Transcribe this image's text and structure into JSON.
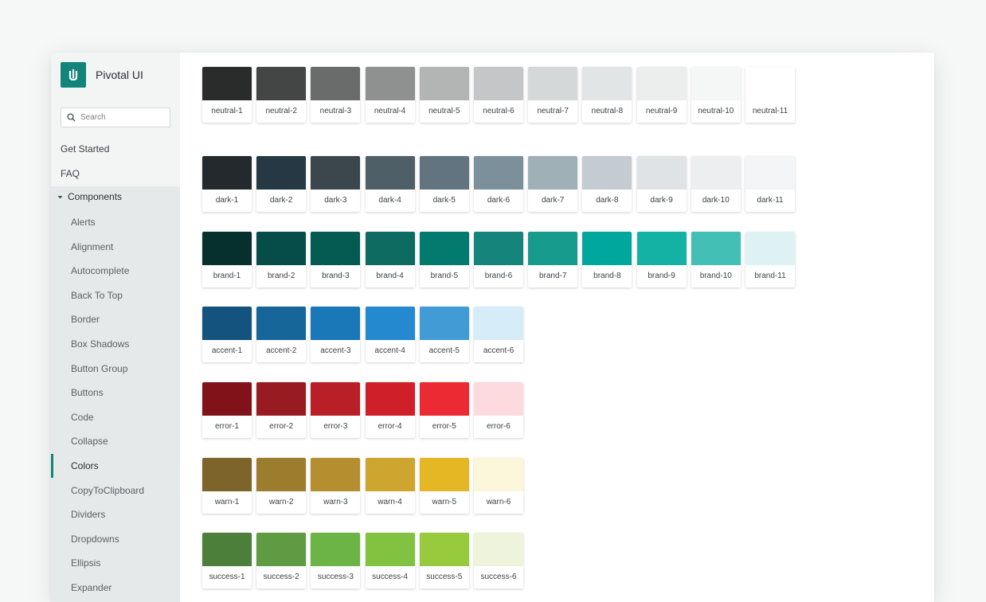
{
  "app": {
    "name": "Pivotal UI"
  },
  "search": {
    "placeholder": "Search"
  },
  "nav": {
    "top_items": [
      "Get Started",
      "FAQ"
    ],
    "section_label": "Components",
    "items": [
      "Alerts",
      "Alignment",
      "Autocomplete",
      "Back To Top",
      "Border",
      "Box Shadows",
      "Button Group",
      "Buttons",
      "Code",
      "Collapse",
      "Colors",
      "CopyToClipboard",
      "Dividers",
      "Dropdowns",
      "Ellipsis",
      "Expander"
    ],
    "active_item": "Colors"
  },
  "palette": [
    {
      "group": "neutral",
      "swatches": [
        {
          "name": "neutral-1",
          "color": "#2a2b2b"
        },
        {
          "name": "neutral-2",
          "color": "#444545"
        },
        {
          "name": "neutral-3",
          "color": "#6a6b6b"
        },
        {
          "name": "neutral-4",
          "color": "#8f9090"
        },
        {
          "name": "neutral-5",
          "color": "#b3b4b4"
        },
        {
          "name": "neutral-6",
          "color": "#c5c6c7"
        },
        {
          "name": "neutral-7",
          "color": "#d4d8d8"
        },
        {
          "name": "neutral-8",
          "color": "#e2e5e5"
        },
        {
          "name": "neutral-9",
          "color": "#eceeee"
        },
        {
          "name": "neutral-10",
          "color": "#f5f6f6"
        },
        {
          "name": "neutral-11",
          "color": "#ffffff"
        }
      ]
    },
    {
      "group": "dark",
      "swatches": [
        {
          "name": "dark-1",
          "color": "#23292d"
        },
        {
          "name": "dark-2",
          "color": "#263844"
        },
        {
          "name": "dark-3",
          "color": "#3b464d"
        },
        {
          "name": "dark-4",
          "color": "#4f5f67"
        },
        {
          "name": "dark-5",
          "color": "#627480"
        },
        {
          "name": "dark-6",
          "color": "#7b909a"
        },
        {
          "name": "dark-7",
          "color": "#9fb0b7"
        },
        {
          "name": "dark-8",
          "color": "#c4ccd1"
        },
        {
          "name": "dark-9",
          "color": "#dfe3e5"
        },
        {
          "name": "dark-10",
          "color": "#eceef0"
        },
        {
          "name": "dark-11",
          "color": "#f4f5f6"
        }
      ]
    },
    {
      "group": "brand",
      "swatches": [
        {
          "name": "brand-1",
          "color": "#05302e"
        },
        {
          "name": "brand-2",
          "color": "#064d4a"
        },
        {
          "name": "brand-3",
          "color": "#055a52"
        },
        {
          "name": "brand-4",
          "color": "#0e6b62"
        },
        {
          "name": "brand-5",
          "color": "#037a6e"
        },
        {
          "name": "brand-6",
          "color": "#15847b"
        },
        {
          "name": "brand-7",
          "color": "#179b8d"
        },
        {
          "name": "brand-8",
          "color": "#00a79d"
        },
        {
          "name": "brand-9",
          "color": "#14b2a4"
        },
        {
          "name": "brand-10",
          "color": "#43bfb6"
        },
        {
          "name": "brand-11",
          "color": "#dff2f3"
        }
      ]
    },
    {
      "group": "accent",
      "swatches": [
        {
          "name": "accent-1",
          "color": "#14537d"
        },
        {
          "name": "accent-2",
          "color": "#16669a"
        },
        {
          "name": "accent-3",
          "color": "#1b78b8"
        },
        {
          "name": "accent-4",
          "color": "#2589cf"
        },
        {
          "name": "accent-5",
          "color": "#419cd6"
        },
        {
          "name": "accent-6",
          "color": "#d6ecf9"
        }
      ]
    },
    {
      "group": "error",
      "swatches": [
        {
          "name": "error-1",
          "color": "#81121a"
        },
        {
          "name": "error-2",
          "color": "#991b22"
        },
        {
          "name": "error-3",
          "color": "#b81f27"
        },
        {
          "name": "error-4",
          "color": "#cf1f28"
        },
        {
          "name": "error-5",
          "color": "#ec2a33"
        },
        {
          "name": "error-6",
          "color": "#fcdadd"
        }
      ]
    },
    {
      "group": "warn",
      "swatches": [
        {
          "name": "warn-1",
          "color": "#7d642b"
        },
        {
          "name": "warn-2",
          "color": "#9c7d2e"
        },
        {
          "name": "warn-3",
          "color": "#b58f2f"
        },
        {
          "name": "warn-4",
          "color": "#cda52f"
        },
        {
          "name": "warn-5",
          "color": "#e6b725"
        },
        {
          "name": "warn-6",
          "color": "#fcf6da"
        }
      ]
    },
    {
      "group": "success",
      "swatches": [
        {
          "name": "success-1",
          "color": "#4b7f3a"
        },
        {
          "name": "success-2",
          "color": "#5f9b42"
        },
        {
          "name": "success-3",
          "color": "#6cb445"
        },
        {
          "name": "success-4",
          "color": "#82c241"
        },
        {
          "name": "success-5",
          "color": "#97ca3c"
        },
        {
          "name": "success-6",
          "color": "#eef4dc"
        }
      ]
    }
  ]
}
